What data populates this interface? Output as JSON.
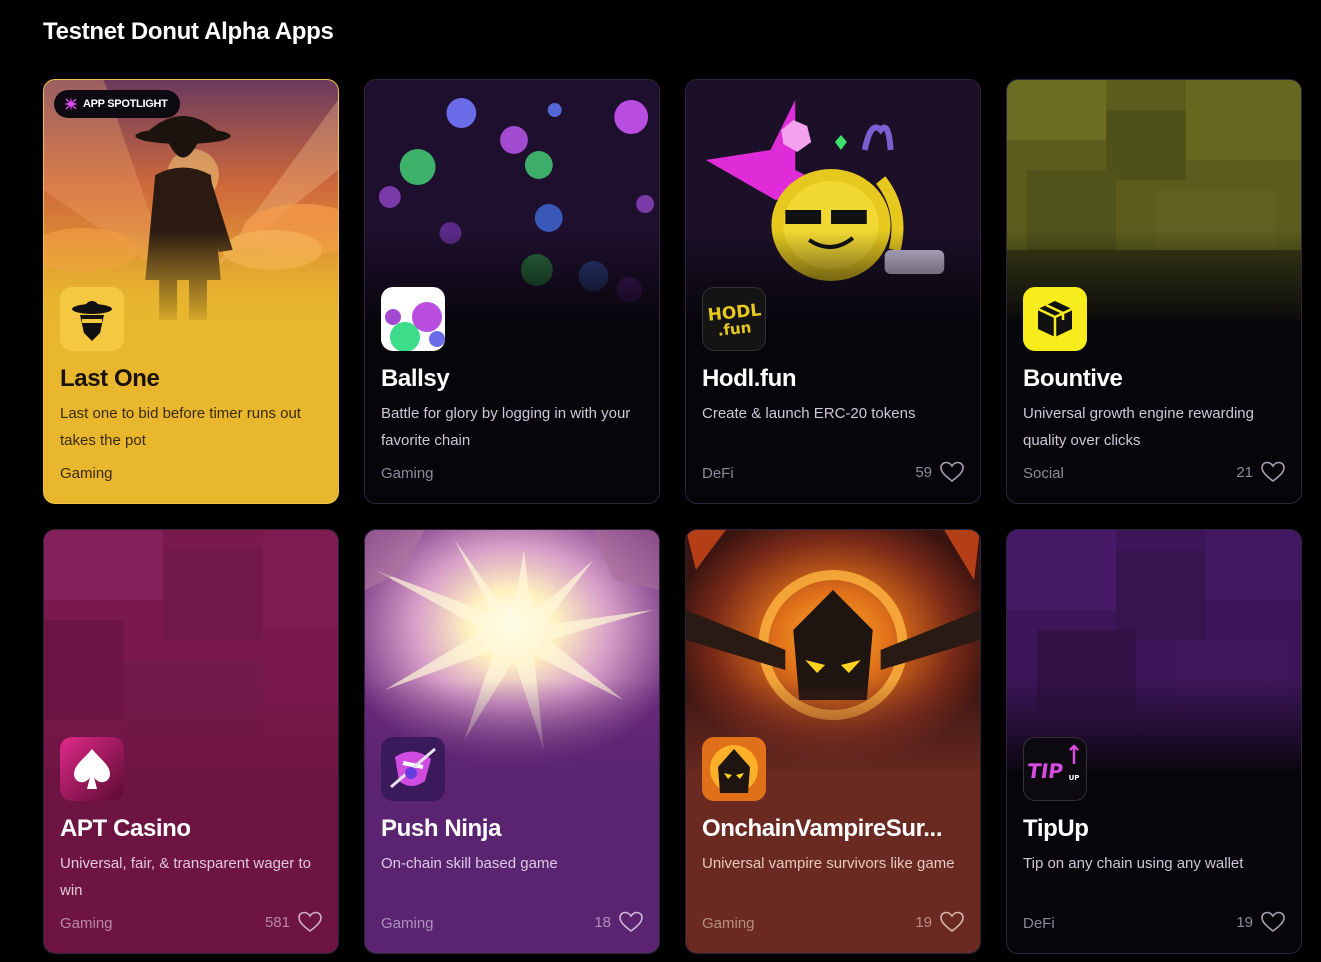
{
  "page": {
    "title": "Testnet Donut Alpha Apps"
  },
  "colors": {
    "accent": "#c026d3",
    "spotlight_yellow": "#e8b72e",
    "muted": "#8f879a"
  },
  "cards": [
    {
      "name": "Last One",
      "description": "Last one to bid before timer runs out takes the pot",
      "category": "Gaming",
      "likes": "",
      "badge": "APP SPOTLIGHT",
      "icon": "cowboy-icon"
    },
    {
      "name": "Ballsy",
      "description": "Battle for glory by logging in with your favorite chain",
      "category": "Gaming",
      "likes": "",
      "icon": "bubbles-icon"
    },
    {
      "name": "Hodl.fun",
      "description": "Create & launch ERC-20 tokens",
      "category": "DeFi",
      "likes": "59",
      "icon": "hodl-fun-logo-icon",
      "logo_text": [
        "HODL",
        ".fun"
      ]
    },
    {
      "name": "Bountive",
      "description": "Universal growth engine rewarding quality over clicks",
      "category": "Social",
      "likes": "21",
      "icon": "box-icon"
    },
    {
      "name": "APT Casino",
      "description": "Universal, fair, & transparent wager to win",
      "category": "Gaming",
      "likes": "581",
      "icon": "spade-icon"
    },
    {
      "name": "Push Ninja",
      "description": "On-chain skill based game",
      "category": "Gaming",
      "likes": "18",
      "icon": "ninja-icon"
    },
    {
      "name": "OnchainVampireSur...",
      "description": "Universal vampire survivors like game",
      "category": "Gaming",
      "likes": "19",
      "icon": "vampire-icon"
    },
    {
      "name": "TipUp",
      "description": "Tip on any chain using any wallet",
      "category": "DeFi",
      "likes": "19",
      "icon": "tipup-logo-icon",
      "logo_text": [
        "TIP",
        "UP"
      ]
    }
  ]
}
